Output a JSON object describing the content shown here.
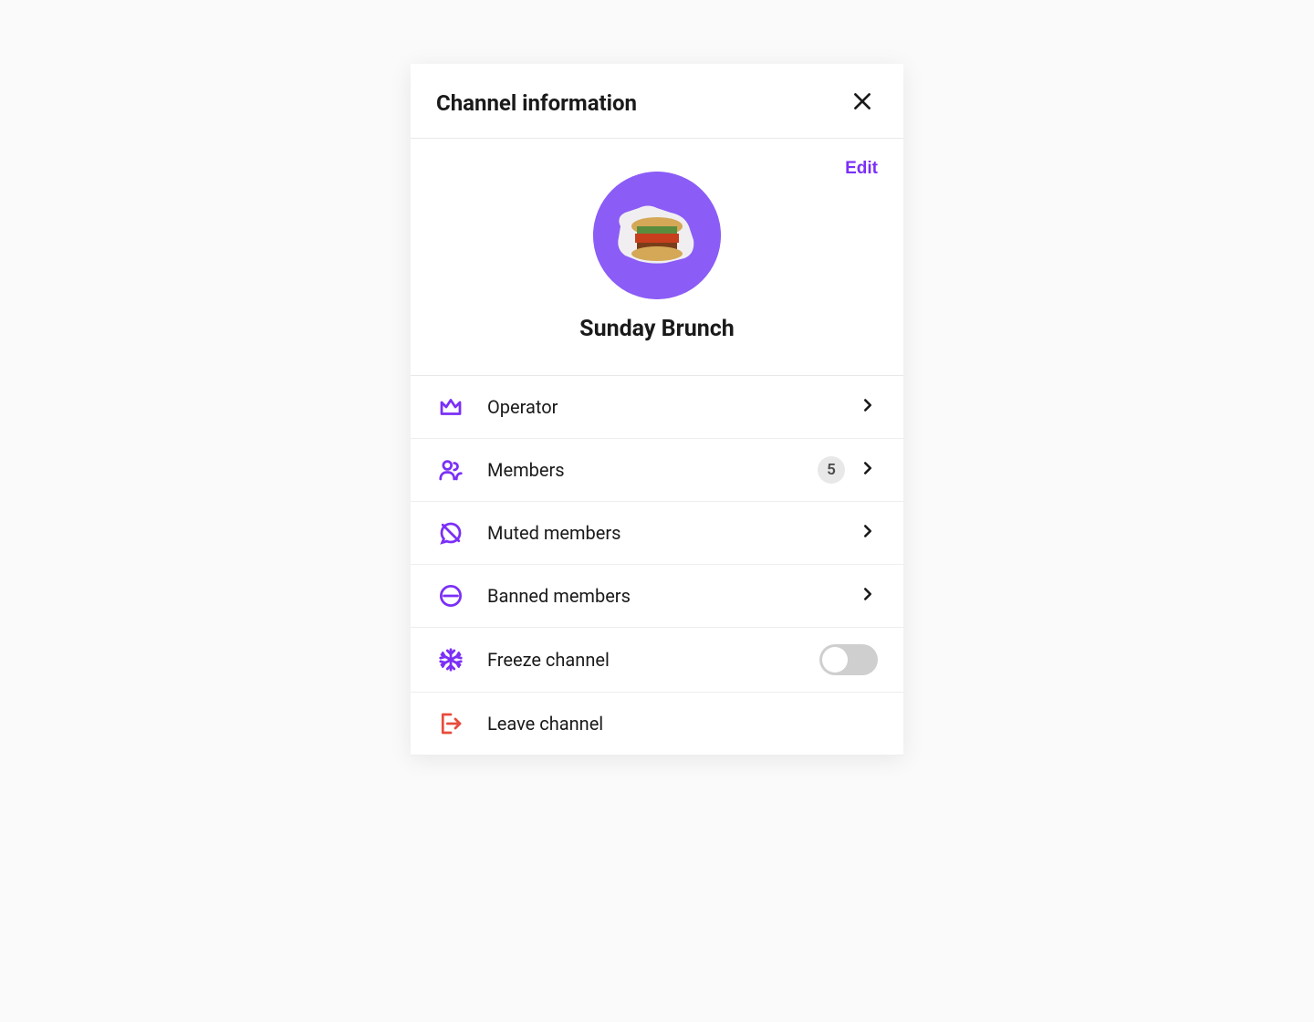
{
  "header": {
    "title": "Channel information"
  },
  "profile": {
    "edit_label": "Edit",
    "channel_name": "Sunday Brunch"
  },
  "menu": {
    "operator": {
      "label": "Operator"
    },
    "members": {
      "label": "Members",
      "count": "5"
    },
    "muted": {
      "label": "Muted members"
    },
    "banned": {
      "label": "Banned members"
    },
    "freeze": {
      "label": "Freeze channel",
      "toggled": false
    },
    "leave": {
      "label": "Leave channel"
    }
  },
  "colors": {
    "accent": "#7b2ff7",
    "danger": "#e74c3c"
  }
}
